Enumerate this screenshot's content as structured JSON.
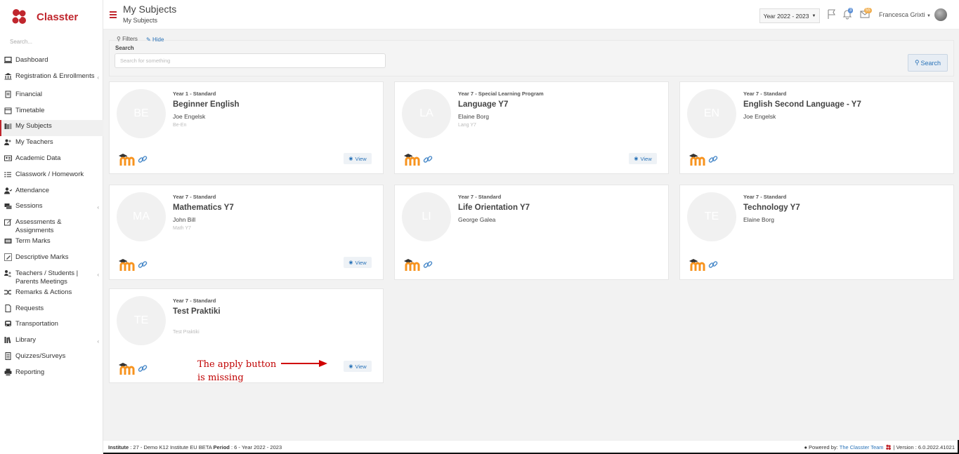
{
  "app": {
    "name": "Classter"
  },
  "sidebar": {
    "search_placeholder": "Search...",
    "items": [
      {
        "label": "Dashboard",
        "icon": "monitor-icon"
      },
      {
        "label": "Registration & Enrollments",
        "icon": "institution-icon",
        "chevron": true
      },
      {
        "label": "Financial",
        "icon": "invoice-icon"
      },
      {
        "label": "Timetable",
        "icon": "calendar-icon"
      },
      {
        "label": "My Subjects",
        "icon": "book-icon",
        "active": true
      },
      {
        "label": "My Teachers",
        "icon": "users-icon"
      },
      {
        "label": "Academic Data",
        "icon": "id-card-icon"
      },
      {
        "label": "Classwork / Homework",
        "icon": "list-icon"
      },
      {
        "label": "Attendance",
        "icon": "user-check-icon"
      },
      {
        "label": "Sessions",
        "icon": "sessions-icon",
        "chevron": true
      },
      {
        "label": "Assessments & Assignments",
        "icon": "edit-icon"
      },
      {
        "label": "Term Marks",
        "icon": "term-icon"
      },
      {
        "label": "Descriptive Marks",
        "icon": "pencil-square-icon"
      },
      {
        "label": "Teachers / Students | Parents Meetings",
        "icon": "meeting-icon",
        "chevron": true
      },
      {
        "label": "Remarks & Actions",
        "icon": "shuffle-icon"
      },
      {
        "label": "Requests",
        "icon": "file-icon"
      },
      {
        "label": "Transportation",
        "icon": "bus-icon"
      },
      {
        "label": "Library",
        "icon": "library-icon",
        "chevron": true
      },
      {
        "label": "Quizzes/Surveys",
        "icon": "quiz-icon"
      },
      {
        "label": "Reporting",
        "icon": "printer-icon"
      }
    ]
  },
  "header": {
    "title": "My Subjects",
    "breadcrumb": "My Subjects",
    "year_selector": "Year 2022 - 2023",
    "notifications_count": "3",
    "messages_count": "55",
    "user_name": "Francesca Grixti"
  },
  "filters": {
    "filters_label": "Filters",
    "hide_label": "Hide",
    "search_label": "Search",
    "search_placeholder": "Search for something",
    "search_button": "Search"
  },
  "subjects": [
    {
      "initials": "BE",
      "year": "Year 1 - Standard",
      "name": "Beginner English",
      "teacher": "Joe Engelsk",
      "code": "Be-En",
      "view": "View"
    },
    {
      "initials": "LA",
      "year": "Year 7 - Special Learning Program",
      "name": "Language Y7",
      "teacher": "Elaine Borg",
      "code": "Lang Y7",
      "view": "View"
    },
    {
      "initials": "EN",
      "year": "Year 7 - Standard",
      "name": "English Second Language - Y7",
      "teacher": "Joe Engelsk",
      "code": "",
      "view": ""
    },
    {
      "initials": "MA",
      "year": "Year 7 - Standard",
      "name": "Mathematics Y7",
      "teacher": "John Bill",
      "code": "Math Y7",
      "view": "View"
    },
    {
      "initials": "LI",
      "year": "Year 7 - Standard",
      "name": "Life Orientation Y7",
      "teacher": "George Galea",
      "code": "",
      "view": ""
    },
    {
      "initials": "TE",
      "year": "Year 7 - Standard",
      "name": "Technology Y7",
      "teacher": "Elaine Borg",
      "code": "",
      "view": ""
    },
    {
      "initials": "TE",
      "year": "Year 7 - Standard",
      "name": "Test Praktiki",
      "teacher": "",
      "code": "Test Praktiki",
      "view": "View"
    }
  ],
  "annotation": {
    "line1": "The apply button",
    "line2": "is missing"
  },
  "footer": {
    "institute_label": "Institute",
    "institute_value": ": 27 - Demo K12 Institute EU BETA",
    "period_label": "Period",
    "period_value": ": 6 - Year 2022 - 2023",
    "powered_by": "Powered by:",
    "team": "The Classter Team",
    "version": "| Version : 6.0.2022.41021"
  },
  "colors": {
    "brand": "#c0262d",
    "link": "#2a73b8",
    "annotation": "#c00000"
  }
}
